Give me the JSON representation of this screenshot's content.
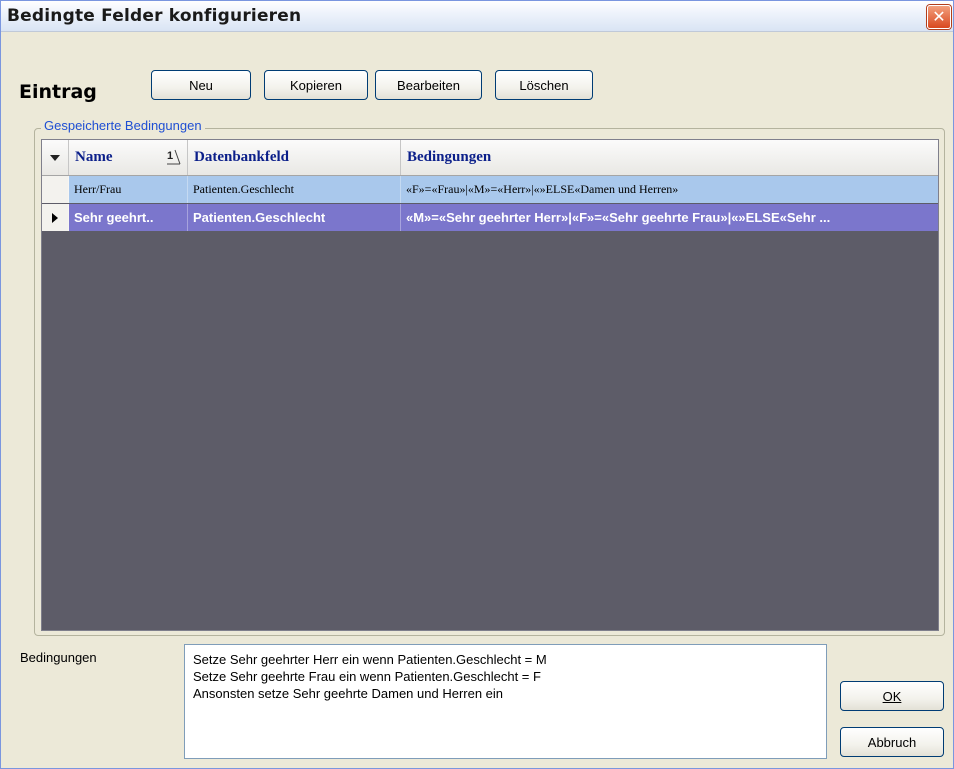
{
  "window": {
    "title": "Bedingte Felder konfigurieren",
    "close_glyph": "✕"
  },
  "entry": {
    "label": "Eintrag",
    "buttons": {
      "new": "Neu",
      "copy": "Kopieren",
      "edit": "Bearbeiten",
      "delete": "Löschen"
    }
  },
  "saved": {
    "group_title": "Gespeicherte Bedingungen",
    "columns": {
      "name": "Name",
      "sort_badge": "1",
      "field": "Datenbankfeld",
      "conditions": "Bedingungen"
    },
    "rows": [
      {
        "name": "Herr/Frau",
        "field": "Patienten.Geschlecht",
        "conditions": "«F»=«Frau»|«M»=«Herr»|«»ELSE«Damen und Herren»",
        "selected": false
      },
      {
        "name": "Sehr geehrt..",
        "field": "Patienten.Geschlecht",
        "conditions": "«M»=«Sehr geehrter Herr»|«F»=«Sehr geehrte Frau»|«»ELSE«Sehr ...",
        "selected": true
      }
    ]
  },
  "details": {
    "label": "Bedingungen",
    "lines": [
      "Setze Sehr geehrter Herr ein wenn Patienten.Geschlecht = M",
      "Setze Sehr geehrte Frau ein wenn Patienten.Geschlecht = F",
      "Ansonsten setze Sehr geehrte Damen und Herren ein"
    ]
  },
  "actions": {
    "ok": "OK",
    "cancel": "Abbruch"
  },
  "icons": {
    "close": "close-icon",
    "sort": "sort-ascending-icon",
    "row_pointer": "row-pointer-icon",
    "filter": "filter-dropdown-icon"
  },
  "colors": {
    "header_text": "#0b1f8a",
    "row_highlight": "#a9c8ec",
    "row_selected": "#7b76cc",
    "grid_background": "#5d5c68",
    "group_title": "#1f4fd3"
  }
}
